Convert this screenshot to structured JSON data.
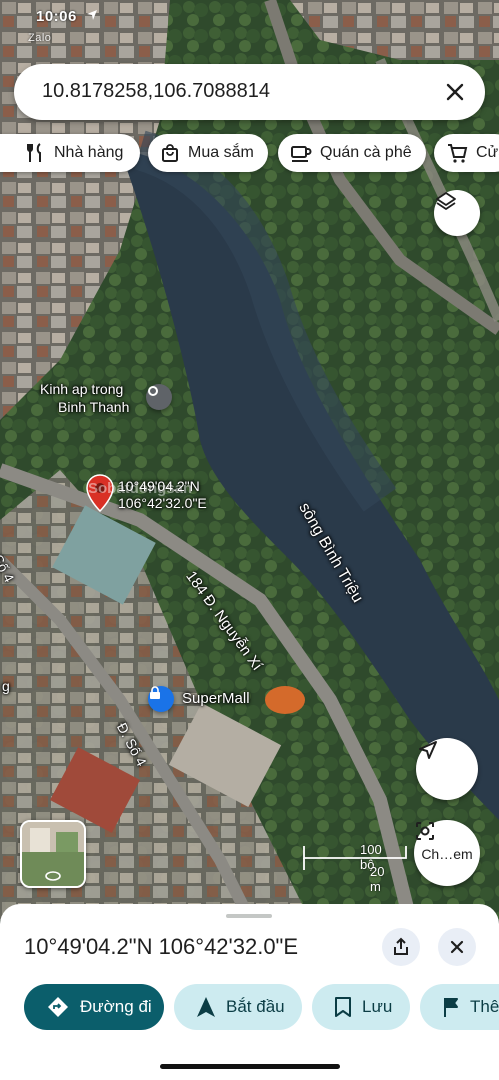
{
  "status": {
    "time": "10:06",
    "carrier": "Zalo"
  },
  "search": {
    "query": "10.8178258,106.7088814",
    "clear_icon": "close-icon"
  },
  "chips": [
    {
      "label": "Nhà hàng",
      "icon": "restaurant-icon"
    },
    {
      "label": "Mua sắm",
      "icon": "shopping-bag-icon"
    },
    {
      "label": "Quán cà phê",
      "icon": "coffee-icon"
    },
    {
      "label": "Cửa",
      "icon": "cart-icon"
    }
  ],
  "map": {
    "labels": {
      "place_line1": "Kinh ap trong",
      "place_line2": "Binh Thanh",
      "river": "sông Bình Triệu",
      "pin_lat": "10°49'04.2\"N",
      "pin_lng": "106°42'32.0\"E",
      "street_main": "184 Đ. Nguyễn Xí",
      "street_so4_a": "Đ. Số 4",
      "street_so4_b": "Số 4",
      "poi": "SuperMall",
      "edge_g": "g",
      "watermark": "Sobatdongsan"
    },
    "scale": {
      "imperial": "100 bộ",
      "metric": "20 m"
    },
    "explore_label": "Ch…em"
  },
  "sheet": {
    "title": "10°49'04.2\"N 106°42'32.0\"E",
    "actions": [
      {
        "label": "Đường đi",
        "icon": "directions-icon",
        "style": "primary"
      },
      {
        "label": "Bắt đầu",
        "icon": "navigation-arrow-icon",
        "style": "tonal"
      },
      {
        "label": "Lưu",
        "icon": "bookmark-icon",
        "style": "tonal"
      },
      {
        "label": "Thê",
        "icon": "flag-icon",
        "style": "tonal"
      }
    ]
  },
  "colors": {
    "primary": "#0b5e6b",
    "tonal": "#cdebf0",
    "pin": "#d93025",
    "poi": "#1a73e8"
  }
}
